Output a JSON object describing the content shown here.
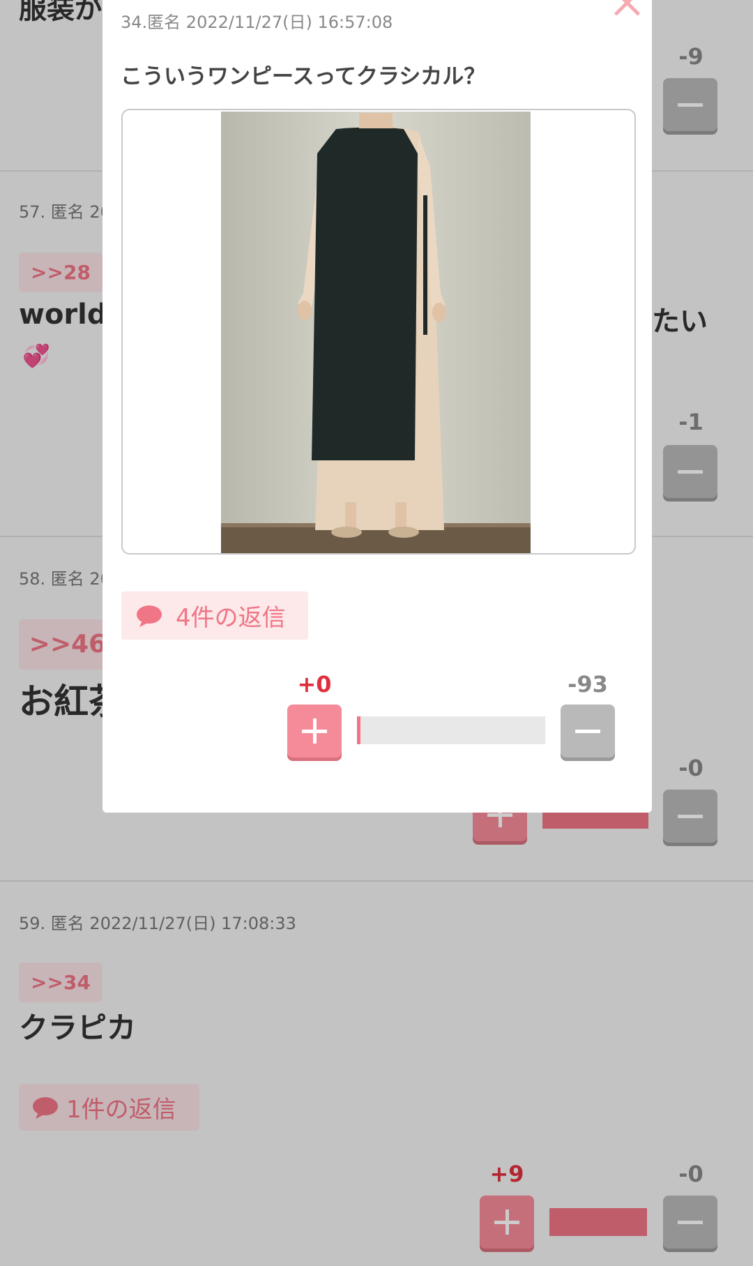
{
  "background": {
    "comments": [
      {
        "partial_text": "服装が",
        "minus_count": "-9"
      },
      {
        "meta": "57. 匿名 20",
        "anchor": ">>28",
        "text_left": "worldw",
        "text_right": "たい",
        "emoji": "💞",
        "minus_count": "-1"
      },
      {
        "meta": "58. 匿名 20",
        "anchor": ">>46",
        "text": "お紅茶",
        "minus_count": "-0"
      },
      {
        "meta": "59. 匿名 2022/11/27(日) 17:08:33",
        "anchor": ">>34",
        "text": "クラピカ",
        "reply_label": "1件の返信",
        "plus_count": "+9",
        "minus_count": "-0",
        "vote_ratio": 1.0
      }
    ]
  },
  "modal": {
    "meta": "34.匿名 2022/11/27(日) 16:57:08",
    "text": "こういうワンピースってクラシカル？",
    "image_alt": "dress-photo",
    "reply_label": "4件の返信",
    "plus_count": "+0",
    "minus_count": "-93",
    "vote_ratio": 0.0
  },
  "colors": {
    "accent": "#f07585",
    "plus": "#f58b98",
    "minus": "#b9b9b9",
    "bar_bg": "#e8e8e8"
  },
  "icons": {
    "close": "close-icon",
    "reply": "speech-bubble-icon",
    "plus": "plus-icon",
    "minus": "minus-icon"
  }
}
